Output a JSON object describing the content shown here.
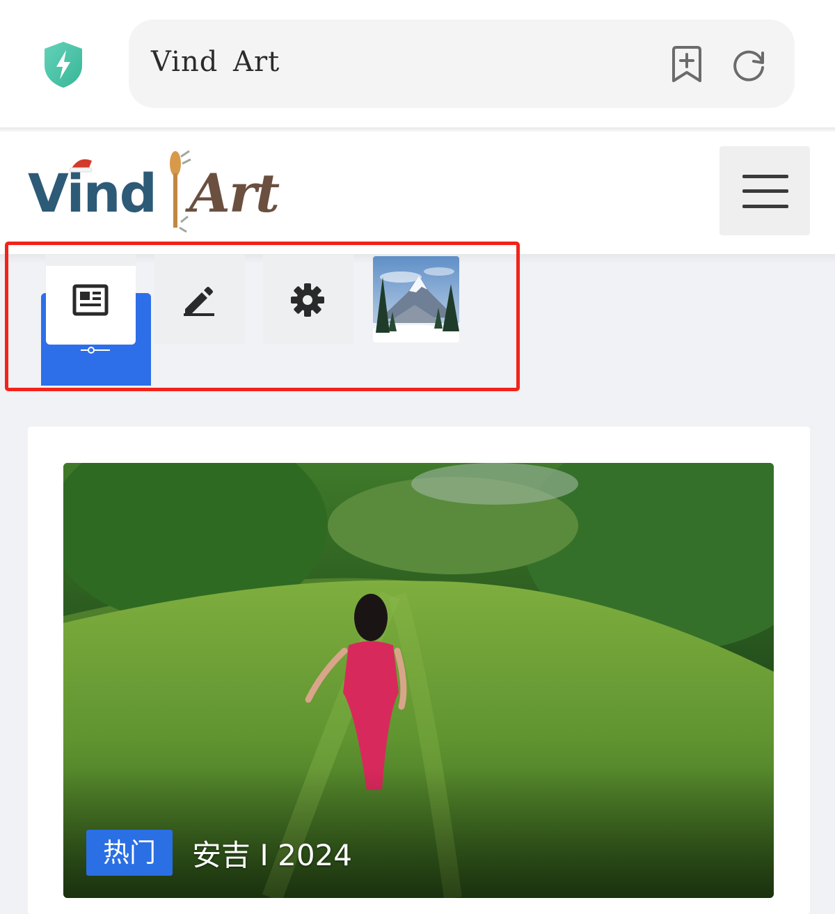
{
  "browser": {
    "url_text": "Vind Art",
    "icons": {
      "security": "shield-bolt-icon",
      "bookmark": "bookmark-add-icon",
      "refresh": "refresh-icon"
    }
  },
  "site": {
    "logo_text": "Vind Art",
    "menu_icon": "hamburger-menu-icon"
  },
  "toolbar": {
    "items": [
      {
        "icon": "news-article-icon",
        "active": true
      },
      {
        "icon": "edit-pencil-icon",
        "active": false
      },
      {
        "icon": "settings-gear-icon",
        "active": false
      },
      {
        "icon": "mountain-thumbnail",
        "active": false
      }
    ],
    "accent_color": "#2d6fe8",
    "highlight_color": "#f2231b"
  },
  "featured": {
    "badge": "热门",
    "title": "安吉 I 2024",
    "badge_color": "#2a6fe3"
  }
}
